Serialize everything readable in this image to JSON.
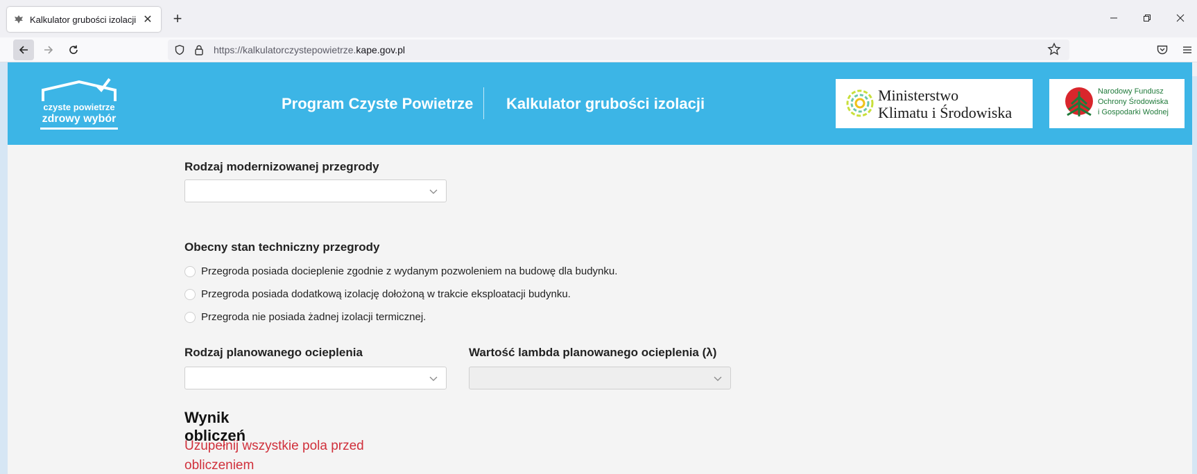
{
  "browser": {
    "tab_title": "Kalkulator grubości izolacji",
    "url_prefix": "https://kalkulatorczystepowietrze.",
    "url_domain": "kape.gov.pl"
  },
  "header": {
    "logo": {
      "line1": "czyste powietrze",
      "line2": "zdrowy wybór"
    },
    "nav": [
      {
        "label": "Program Czyste Powietrze"
      },
      {
        "label": "Kalkulator grubości izolacji"
      }
    ],
    "ministry": {
      "line1": "Ministerstwo",
      "line2": "Klimatu i Środowiska"
    },
    "fund": {
      "line1": "Narodowy Fundusz",
      "line2": "Ochrony Środowiska",
      "line3": "i Gospodarki Wodnej"
    }
  },
  "form": {
    "partition_type_label": "Rodzaj modernizowanej przegrody",
    "partition_type_value": "",
    "state_label": "Obecny stan techniczny przegrody",
    "state_options": [
      "Przegroda posiada docieplenie zgodnie z wydanym pozwoleniem na budowę dla budynku.",
      "Przegroda posiada dodatkową izolację dołożoną w trakcie eksploatacji budynku.",
      "Przegroda nie posiada żadnej izolacji termicznej."
    ],
    "insulation_type_label": "Rodzaj planowanego ocieplenia",
    "insulation_type_value": "",
    "lambda_label": "Wartość lambda planowanego ocieplenia (λ)",
    "lambda_value": ""
  },
  "result": {
    "title": "Wynik obliczeń",
    "message": "Uzupełnij wszystkie pola przed obliczeniem"
  },
  "colors": {
    "header_bg": "#3cb5e6",
    "error_text": "#d0303b",
    "fund_text": "#1f7a3a"
  }
}
